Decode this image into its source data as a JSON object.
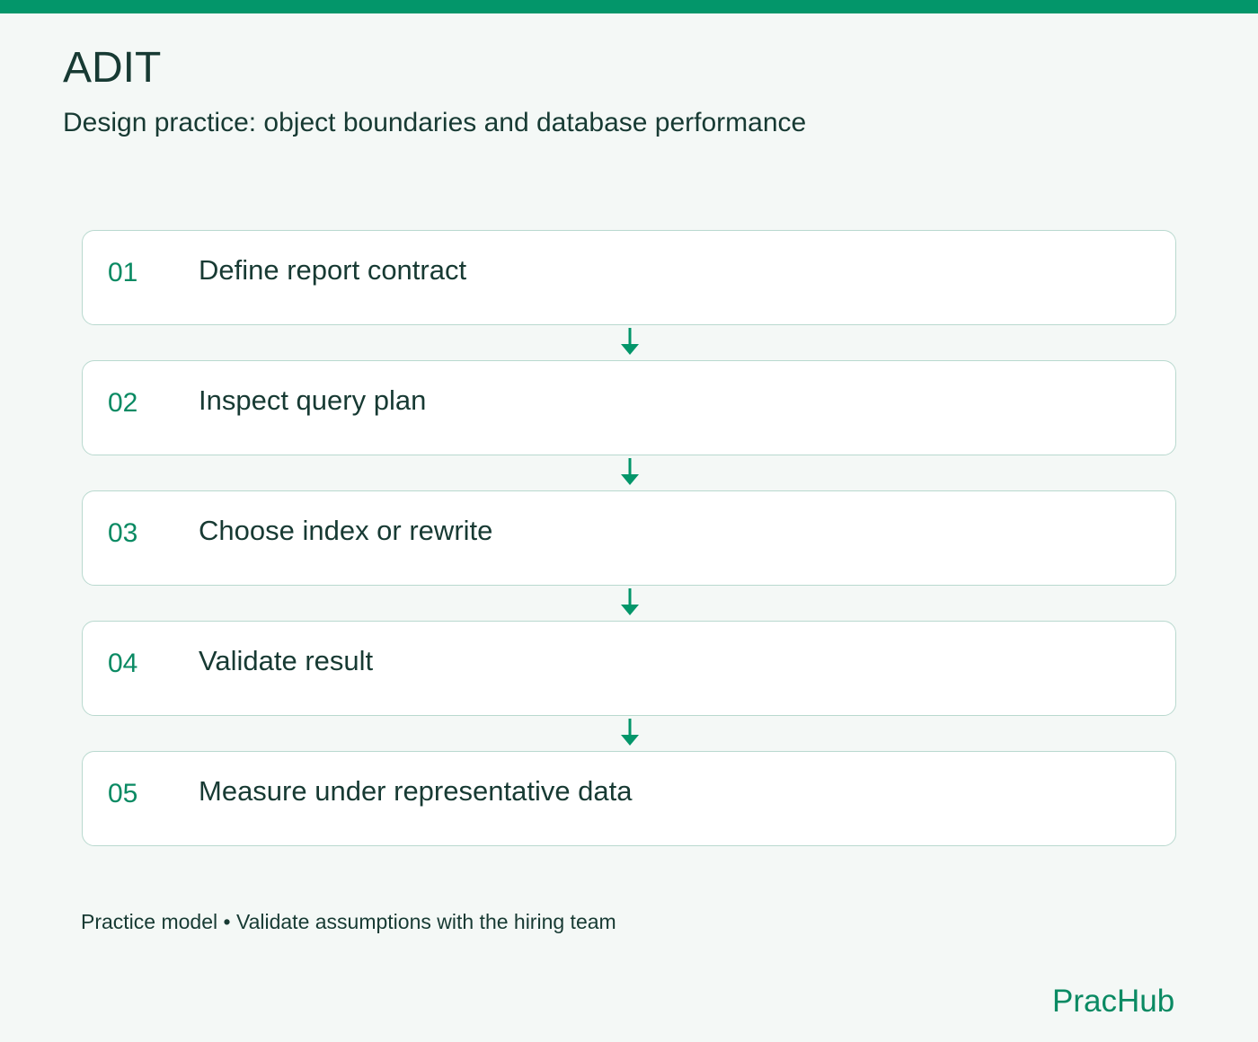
{
  "header": {
    "title": "ADIT",
    "subtitle": "Design practice: object boundaries and database performance"
  },
  "steps": [
    {
      "number": "01",
      "label": "Define report contract"
    },
    {
      "number": "02",
      "label": "Inspect query plan"
    },
    {
      "number": "03",
      "label": "Choose index or rewrite"
    },
    {
      "number": "04",
      "label": "Validate result"
    },
    {
      "number": "05",
      "label": "Measure under representative data"
    }
  ],
  "footer": {
    "note": "Practice model • Validate assumptions with the hiring team",
    "brand": "PracHub"
  },
  "colors": {
    "accent": "#03966a",
    "text": "#173a33",
    "card_border": "#b9d9cf",
    "background": "#f4f8f6"
  },
  "icons": {
    "connector": "arrow-down-icon"
  }
}
